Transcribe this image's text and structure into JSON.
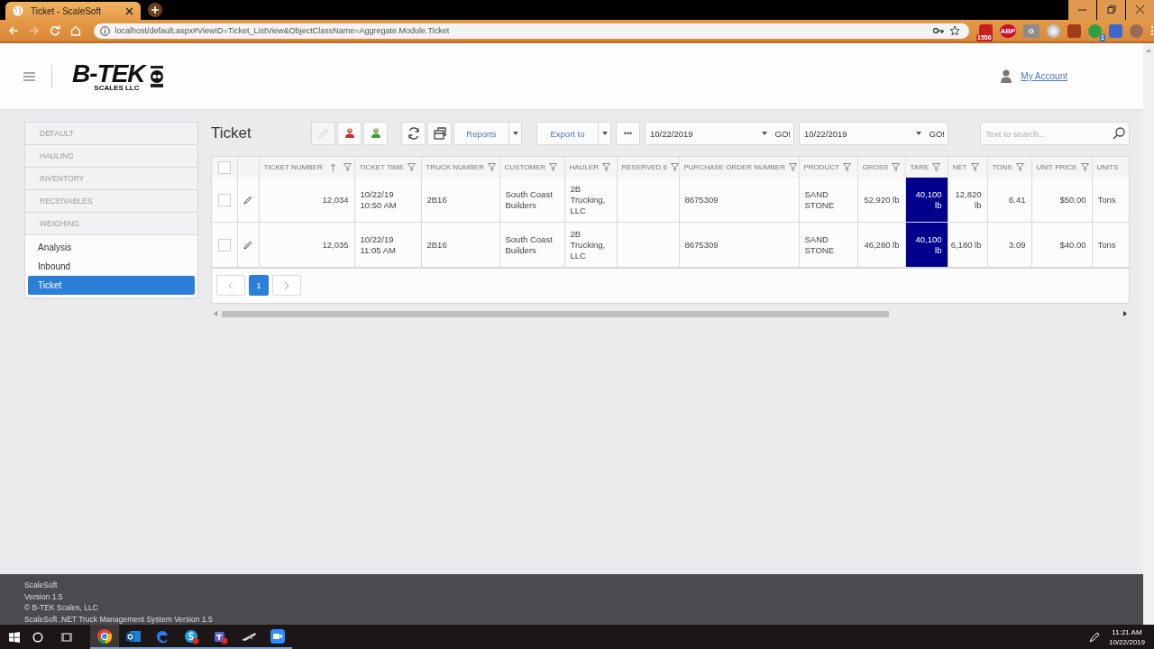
{
  "browser": {
    "tab_title": "Ticket - ScaleSoft",
    "url": "localhost/default.aspx#ViewID=Ticket_ListView&ObjectClassName=Aggregate.Module.Ticket",
    "extensions": [
      {
        "kind": "mail",
        "badge": "1556"
      },
      {
        "kind": "abp",
        "text": "ABP"
      },
      {
        "kind": "letter",
        "text": "G"
      },
      {
        "kind": "disc"
      },
      {
        "kind": "pdf"
      },
      {
        "kind": "chat",
        "badge": "1"
      },
      {
        "kind": "cast"
      },
      {
        "kind": "avatar"
      }
    ]
  },
  "header": {
    "logo": {
      "wordmark": "B-TEK",
      "subtitle": "SCALES LLC"
    },
    "account_link": "My Account"
  },
  "sidebar": {
    "groups": [
      {
        "label": "DEFAULT"
      },
      {
        "label": "HAULING"
      },
      {
        "label": "INVENTORY"
      },
      {
        "label": "RECEIVABLES"
      },
      {
        "label": "WEIGHING",
        "children": [
          {
            "label": "Analysis",
            "selected": false
          },
          {
            "label": "Inbound",
            "selected": false
          },
          {
            "label": "Ticket",
            "selected": true
          }
        ]
      }
    ]
  },
  "view": {
    "title": "Ticket",
    "toolbar": [
      {
        "kind": "icon",
        "disabled": true
      },
      {
        "kind": "icon",
        "disabled": false
      },
      {
        "kind": "icon",
        "disabled": false
      },
      {
        "kind": "icon",
        "disabled": false
      },
      {
        "kind": "icon",
        "disabled": false
      },
      {
        "kind": "split",
        "label": "Reports"
      },
      {
        "kind": "split",
        "label": "Export to"
      },
      {
        "kind": "text",
        "label": "•••"
      },
      {
        "kind": "date",
        "value": "10/22/2019",
        "go": "GO!"
      },
      {
        "kind": "date",
        "value": "10/22/2019",
        "go": "GO!"
      },
      {
        "kind": "search",
        "placeholder": "Text to search..."
      }
    ],
    "table": {
      "all_checked": false,
      "columns": [
        {
          "label": "TICKET NUMBER",
          "kind": "number",
          "sorted": true,
          "filter": true,
          "highlighted": false
        },
        {
          "label": "TICKET TIME",
          "kind": "text",
          "filter": true,
          "highlighted": false
        },
        {
          "label": "TRUCK NUMBER",
          "kind": "text",
          "filter": true,
          "highlighted": false
        },
        {
          "label": "CUSTOMER",
          "kind": "text",
          "filter": true,
          "highlighted": false
        },
        {
          "label": "HAULER",
          "kind": "text",
          "filter": true,
          "highlighted": false
        },
        {
          "label": "RESERVED 6",
          "kind": "text",
          "filter": true,
          "highlighted": false
        },
        {
          "label": "PURCHASE ORDER NUMBER",
          "kind": "text",
          "filter": true,
          "highlighted": false
        },
        {
          "label": "PRODUCT",
          "kind": "text",
          "filter": true,
          "highlighted": false
        },
        {
          "label": "GROSS",
          "kind": "number",
          "filter": true,
          "highlighted": false
        },
        {
          "label": "TARE",
          "kind": "number",
          "filter": true,
          "highlighted": true
        },
        {
          "label": "NET",
          "kind": "number",
          "filter": true,
          "highlighted": false
        },
        {
          "label": "TONS",
          "kind": "number",
          "filter": true,
          "highlighted": false
        },
        {
          "label": "UNIT PRICE",
          "kind": "number",
          "filter": true,
          "highlighted": false
        },
        {
          "label": "UNITS",
          "kind": "text",
          "filter": false,
          "highlighted": false
        }
      ],
      "rows": [
        {
          "checked": false,
          "cells": [
            "12,034",
            "10/22/19 10:50 AM",
            "2B16",
            "South Coast Builders",
            "2B Trucking, LLC",
            "",
            "8675309",
            "SAND STONE",
            "52,920 lb",
            "40,100 lb",
            "12,820 lb",
            "6.41",
            "$50.00",
            "Tons"
          ]
        },
        {
          "checked": false,
          "cells": [
            "12,035",
            "10/22/19 11:05 AM",
            "2B16",
            "South Coast Builders",
            "2B Trucking, LLC",
            "",
            "8675309",
            "SAND STONE",
            "46,280 lb",
            "40,100 lb",
            "6,180 lb",
            "3.09",
            "$40.00",
            "Tons"
          ]
        }
      ]
    },
    "pager": {
      "pages": [
        {
          "label": "1",
          "selected": true
        }
      ]
    }
  },
  "footer": {
    "lines": [
      "ScaleSoft",
      "Version 1.5",
      "© B-TEK Scales, LLC",
      "ScaleSoft .NET Truck Management System Version 1.5"
    ]
  },
  "taskbar": {
    "apps": [
      {
        "kind": "chrome",
        "active": true
      },
      {
        "kind": "outlook",
        "active": false
      },
      {
        "kind": "edge",
        "active": false
      },
      {
        "kind": "skype",
        "active": false
      },
      {
        "kind": "teams",
        "active": false
      },
      {
        "kind": "plane",
        "active": false
      },
      {
        "kind": "zoom",
        "active": false
      }
    ],
    "time": "11:21 AM",
    "date": "10/22/2019"
  }
}
